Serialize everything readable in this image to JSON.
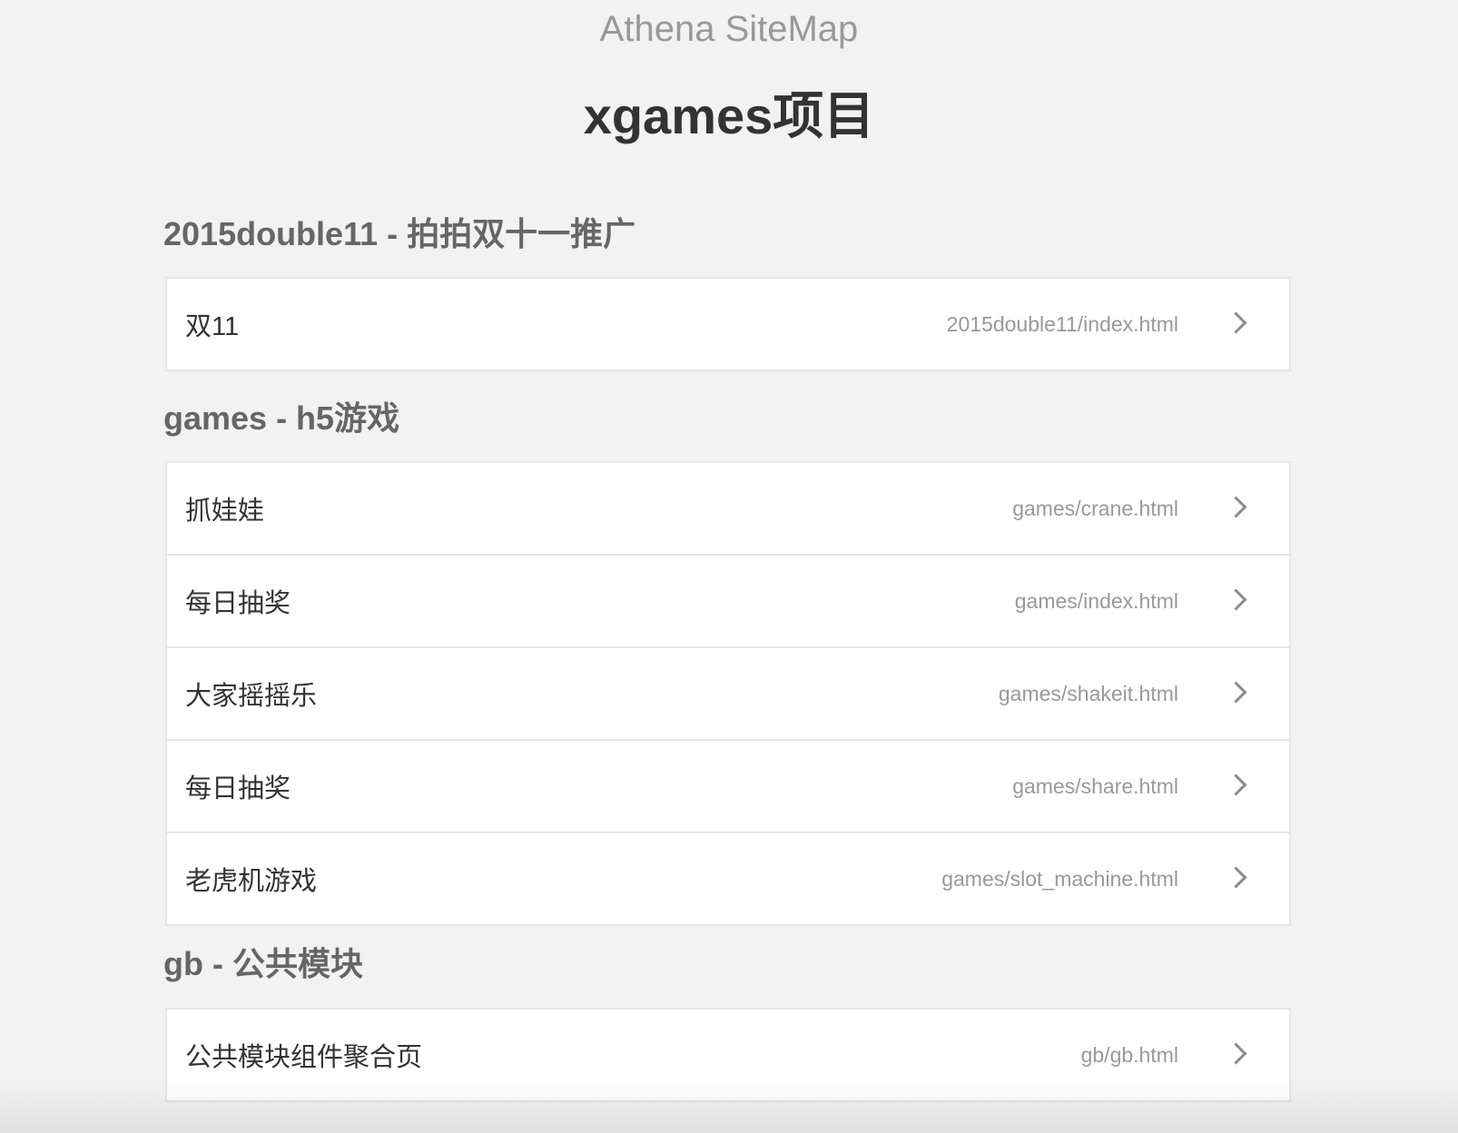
{
  "header": {
    "brand": "Athena SiteMap",
    "project_title": "xgames项目"
  },
  "groups": [
    {
      "title": "2015double11 - 拍拍双十一推广",
      "items": [
        {
          "name": "双11",
          "path": "2015double11/index.html"
        }
      ]
    },
    {
      "title": "games - h5游戏",
      "items": [
        {
          "name": "抓娃娃",
          "path": "games/crane.html"
        },
        {
          "name": "每日抽奖",
          "path": "games/index.html"
        },
        {
          "name": "大家摇摇乐",
          "path": "games/shakeit.html"
        },
        {
          "name": "每日抽奖",
          "path": "games/share.html"
        },
        {
          "name": "老虎机游戏",
          "path": "games/slot_machine.html"
        }
      ]
    },
    {
      "title": "gb - 公共模块",
      "items": [
        {
          "name": "公共模块组件聚合页",
          "path": "gb/gb.html"
        }
      ]
    }
  ],
  "icons": {
    "row_arrow": "chevron-right-icon"
  },
  "colors": {
    "background": "#f2f2f2",
    "card": "#ffffff",
    "border": "#e6e6e6",
    "brand_text": "#999999",
    "title_text": "#333333",
    "group_text": "#666666",
    "path_text": "#999999"
  }
}
